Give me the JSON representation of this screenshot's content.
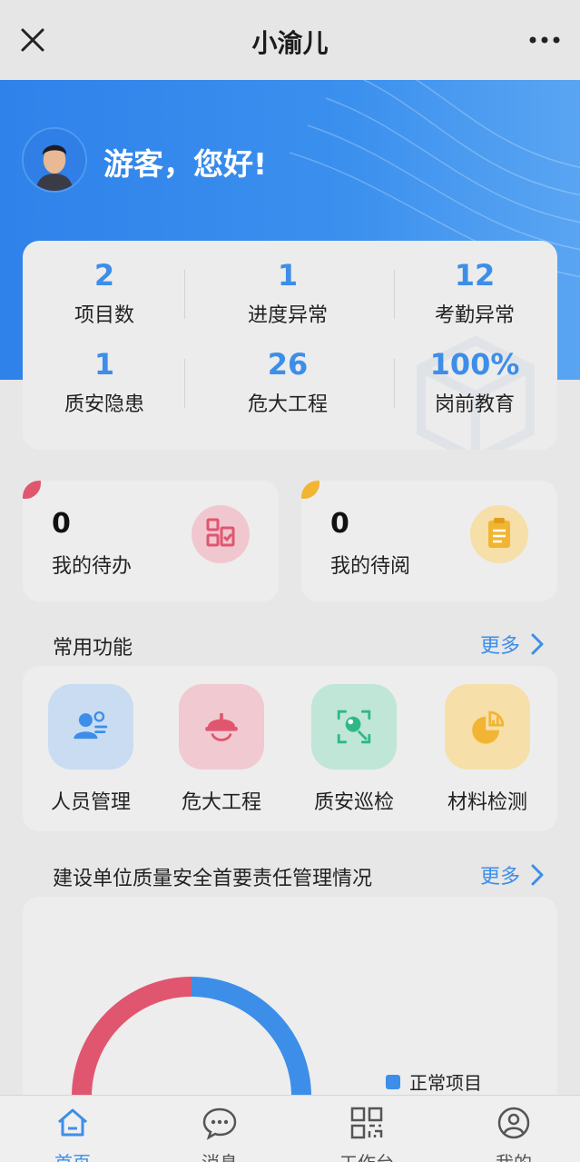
{
  "titlebar": {
    "title": "小渝儿"
  },
  "header": {
    "greeting": "游客，您好!"
  },
  "stats": [
    {
      "value": "2",
      "label": "项目数"
    },
    {
      "value": "1",
      "label": "进度异常"
    },
    {
      "value": "12",
      "label": "考勤异常"
    },
    {
      "value": "1",
      "label": "质安隐患"
    },
    {
      "value": "26",
      "label": "危大工程"
    },
    {
      "value": "100%",
      "label": "岗前教育"
    }
  ],
  "cards": {
    "todo": {
      "count": "0",
      "label": "我的待办",
      "accent": "#e0566f"
    },
    "toread": {
      "count": "0",
      "label": "我的待阅",
      "accent": "#f2b533"
    }
  },
  "common": {
    "title": "常用功能",
    "more": "更多",
    "items": [
      {
        "label": "人员管理",
        "icon": "people-icon",
        "color": "#3d8ee8"
      },
      {
        "label": "危大工程",
        "icon": "helmet-icon",
        "color": "#e0566f"
      },
      {
        "label": "质安巡检",
        "icon": "scan-search-icon",
        "color": "#2fb886"
      },
      {
        "label": "材料检测",
        "icon": "pie-chart-icon",
        "color": "#f2b533"
      }
    ]
  },
  "quality": {
    "title": "建设单位质量安全首要责任管理情况",
    "more": "更多",
    "legend": [
      {
        "label": "正常项目",
        "color": "#3d8ee8"
      }
    ]
  },
  "chart_data": {
    "type": "pie",
    "series": [
      {
        "name": "正常项目",
        "value": 50,
        "color": "#3d8ee8"
      },
      {
        "value": 50,
        "color": "#e0566f"
      }
    ]
  },
  "tabbar": [
    {
      "label": "首页",
      "icon": "home-icon",
      "active": true
    },
    {
      "label": "消息",
      "icon": "message-icon",
      "active": false
    },
    {
      "label": "工作台",
      "icon": "grid-icon",
      "active": false
    },
    {
      "label": "我的",
      "icon": "user-icon",
      "active": false
    }
  ]
}
